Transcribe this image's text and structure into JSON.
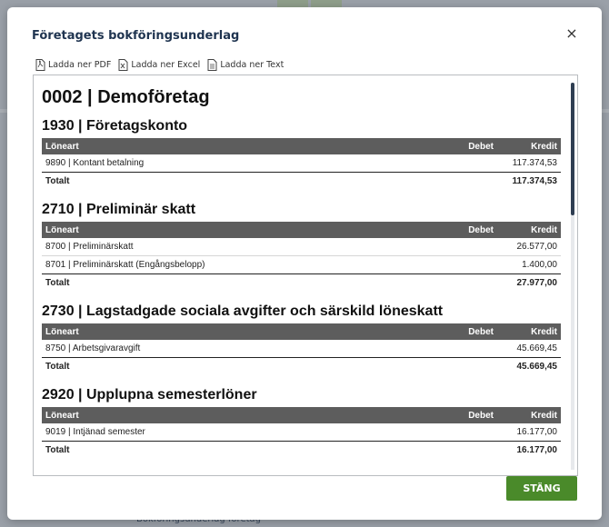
{
  "background": {
    "footer_link": "Bokföringsunderlag företag"
  },
  "modal": {
    "title": "Företagets bokföringsunderlag",
    "close_symbol": "×",
    "toolbar": [
      {
        "label": "Ladda ner PDF",
        "icon": "pdf-file-icon"
      },
      {
        "label": "Ladda ner Excel",
        "icon": "excel-file-icon"
      },
      {
        "label": "Ladda ner Text",
        "icon": "text-file-icon"
      }
    ],
    "close_button": "STÄNG"
  },
  "report": {
    "company": "0002 | Demoföretag",
    "columns": {
      "name": "Löneart",
      "debet": "Debet",
      "kredit": "Kredit"
    },
    "total_label": "Totalt",
    "accounts": [
      {
        "title": "1930 | Företagskonto",
        "rows": [
          {
            "name": "9890 | Kontant betalning",
            "debet": "",
            "kredit": "117.374,53"
          }
        ],
        "total_debet": "",
        "total_kredit": "117.374,53"
      },
      {
        "title": "2710 | Preliminär skatt",
        "rows": [
          {
            "name": "8700 | Preliminärskatt",
            "debet": "",
            "kredit": "26.577,00"
          },
          {
            "name": "8701 | Preliminärskatt (Engångsbelopp)",
            "debet": "",
            "kredit": "1.400,00"
          }
        ],
        "total_debet": "",
        "total_kredit": "27.977,00"
      },
      {
        "title": "2730 | Lagstadgade sociala avgifter och särskild löneskatt",
        "rows": [
          {
            "name": "8750 | Arbetsgivaravgift",
            "debet": "",
            "kredit": "45.669,45"
          }
        ],
        "total_debet": "",
        "total_kredit": "45.669,45"
      },
      {
        "title": "2920 | Upplupna semesterlöner",
        "rows": [
          {
            "name": "9019 | Intjänad semester",
            "debet": "",
            "kredit": "16.177,00"
          }
        ],
        "total_debet": "",
        "total_kredit": "16.177,00"
      }
    ]
  },
  "colors": {
    "title": "#1f3450",
    "table_header_bg": "#5d5d5d",
    "primary_button": "#4a8a2a",
    "scrollbar_thumb": "#2e3e52"
  }
}
